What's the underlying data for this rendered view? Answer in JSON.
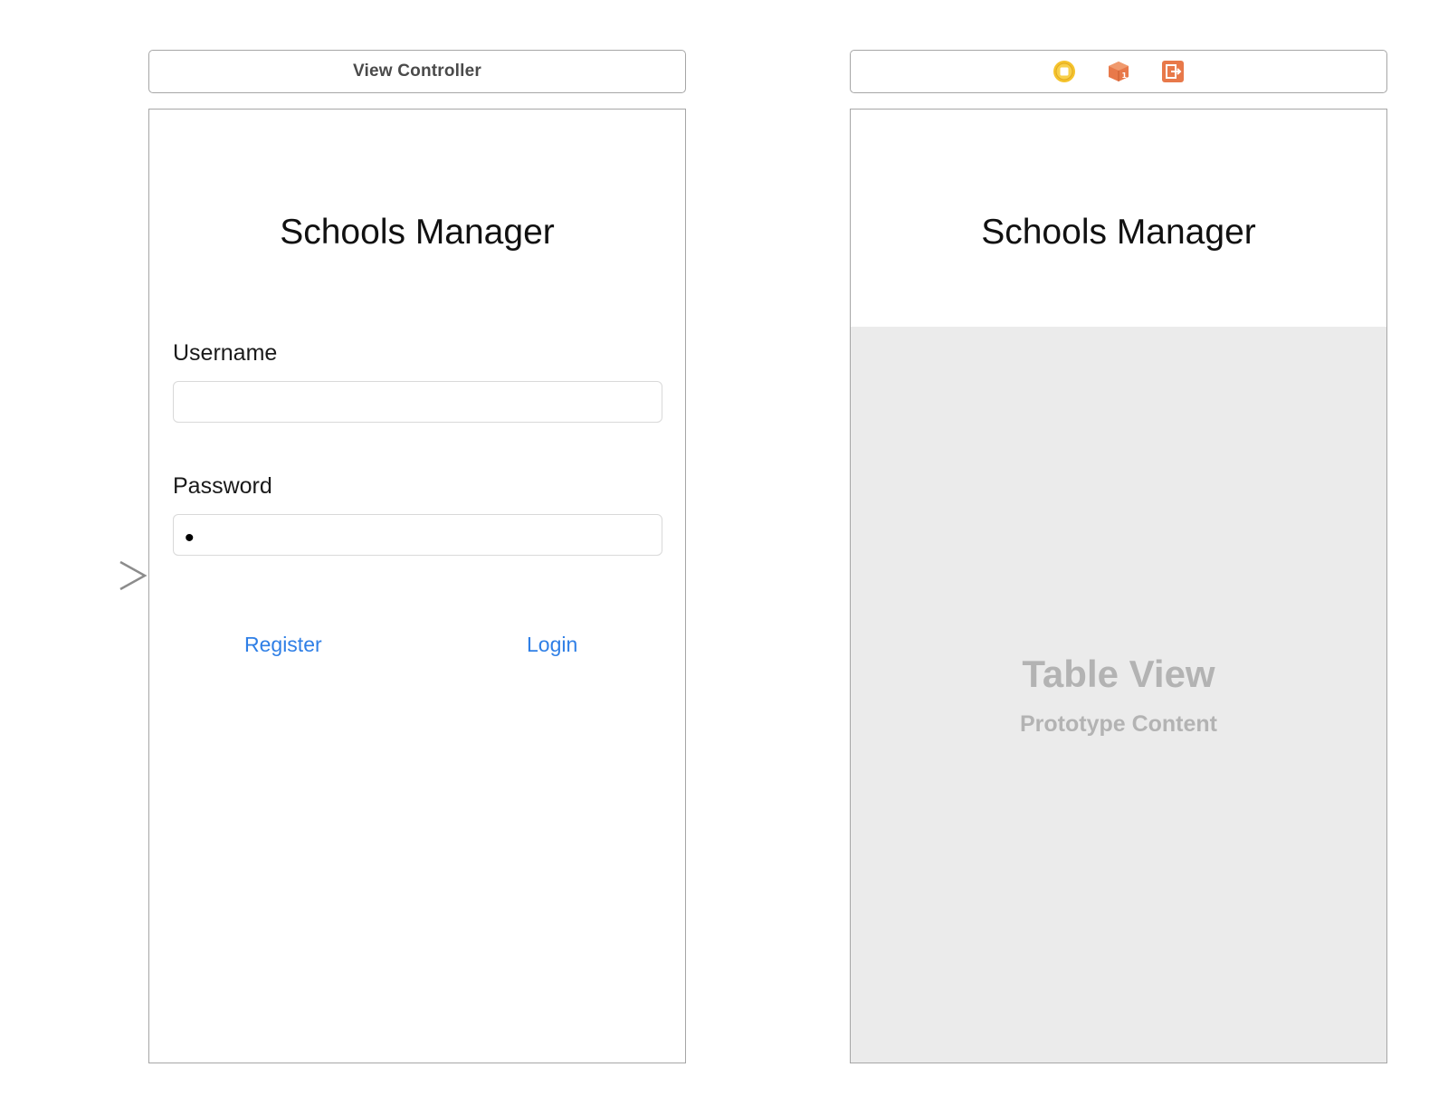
{
  "login_scene": {
    "bar_title": "View Controller",
    "app_title": "Schools Manager",
    "username_label": "Username",
    "username_value": "",
    "password_label": "Password",
    "password_value": "•",
    "register_label": "Register",
    "login_label": "Login"
  },
  "table_scene": {
    "bar_icons": [
      "view-controller-icon",
      "first-responder-icon",
      "exit-icon"
    ],
    "app_title": "Schools Manager",
    "table_title": "Table View",
    "table_subtitle": "Prototype Content"
  },
  "entry_point": {
    "icon": "arrow-right-icon"
  },
  "colors": {
    "link": "#2f7fe6",
    "scene_border": "#a6a6a6",
    "table_background": "#ebebeb",
    "placeholder_text": "#b3b3b3",
    "icon_yellow": "#f5c32c",
    "icon_orange": "#e8794a"
  }
}
